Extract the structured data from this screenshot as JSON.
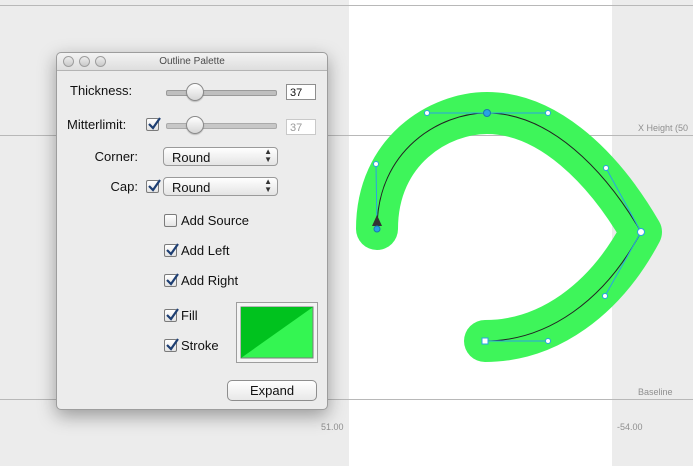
{
  "canvas": {
    "labels": {
      "x_height": "X Height (50",
      "baseline": "Baseline",
      "left_metric": "51.00",
      "right_metric": "-54.00"
    },
    "colors": {
      "outline_fill": "#3ef55a",
      "path_stroke": "#222222",
      "handle_color": "#29a3e3",
      "glyph_background": "#ffffff"
    }
  },
  "palette": {
    "title": "Outline Palette",
    "thickness": {
      "label": "Thickness:",
      "value": "37",
      "slider_fraction": 0.22
    },
    "mitterlimit": {
      "label": "Mitterlimit:",
      "checked": true,
      "value": "37",
      "slider_fraction": 0.22
    },
    "corner": {
      "label": "Corner:",
      "selected": "Round"
    },
    "cap": {
      "label": "Cap:",
      "checked": true,
      "selected": "Round"
    },
    "options": [
      {
        "label": "Add Source",
        "checked": false
      },
      {
        "label": "Add Left",
        "checked": true
      },
      {
        "label": "Add Right",
        "checked": true
      }
    ],
    "fill": {
      "label": "Fill",
      "checked": true,
      "color": "#00c21e"
    },
    "stroke": {
      "label": "Stroke",
      "checked": true,
      "color": "#34f552"
    },
    "expand_label": "Expand"
  }
}
